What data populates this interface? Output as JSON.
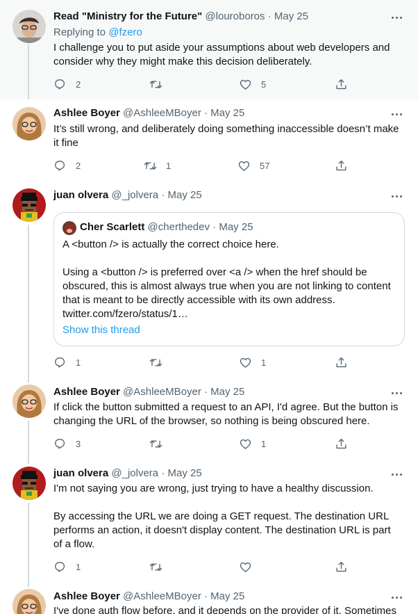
{
  "tweets": [
    {
      "name": "Read \"Ministry for the Future\"",
      "handle": "@louroboros",
      "date": "May 25",
      "replying_label": "Replying to",
      "replying_to": "@fzero",
      "text": "I challenge you to put aside your assumptions about web developers and consider why they might make this decision deliberately.",
      "replies": "2",
      "retweets": "",
      "likes": "5"
    },
    {
      "name": "Ashlee Boyer",
      "handle": "@AshleeMBoyer",
      "date": "May 25",
      "text": "It’s still wrong, and deliberately doing something inaccessible doesn’t make it fine",
      "replies": "2",
      "retweets": "1",
      "likes": "57"
    },
    {
      "name": "juan olvera",
      "handle": "@_jolvera",
      "date": "May 25",
      "quote": {
        "name": "Cher Scarlett",
        "handle": "@cherthedev",
        "date": "May 25",
        "text": "A <button /> is actually the correct choice here.\n\nUsing a <button /> is preferred over <a /> when the href should be obscured, this is almost always true when you are not linking to content that is meant to be directly accessible with its own address. twitter.com/fzero/status/1…",
        "show_thread": "Show this thread"
      },
      "replies": "1",
      "retweets": "",
      "likes": "1"
    },
    {
      "name": "Ashlee Boyer",
      "handle": "@AshleeMBoyer",
      "date": "May 25",
      "text": "If click the button submitted a request to an API, I'd agree. But the button is changing the URL of the browser, so nothing is being obscured here.",
      "replies": "3",
      "retweets": "",
      "likes": "1"
    },
    {
      "name": "juan olvera",
      "handle": "@_jolvera",
      "date": "May 25",
      "text": "I'm not saying you are wrong, just trying to have a healthy discussion.\n\nBy accessing the URL we are doing a GET request. The destination URL performs an action, it doesn't display content. The destination URL is part of a flow.",
      "replies": "1",
      "retweets": "",
      "likes": ""
    },
    {
      "name": "Ashlee Boyer",
      "handle": "@AshleeMBoyer",
      "date": "May 25",
      "text": "I've done auth flow before, and it depends on the provider of it. Sometimes"
    }
  ],
  "separator": "·",
  "icons": {
    "reply": "reply-icon",
    "retweet": "retweet-icon",
    "like": "heart-icon",
    "share": "share-icon",
    "more": "more-icon"
  },
  "colors": {
    "link": "#1d9bf0",
    "secondary": "#536471",
    "highlight_bg": "#f7f9f9",
    "thread_line": "#cfd9de"
  }
}
